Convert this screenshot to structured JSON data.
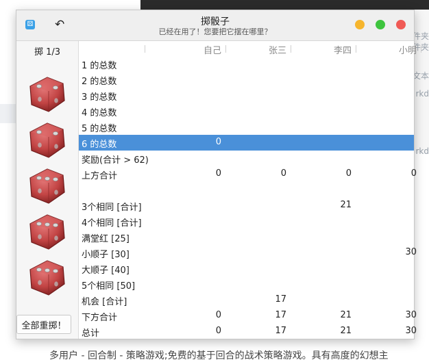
{
  "window": {
    "title": "掷骰子",
    "subtitle": "已经在用了！您要把它摆在哪里？"
  },
  "sidebar": {
    "roll_label": "掷 1/3",
    "dice": [
      {
        "value": 2,
        "kind": "die-icon"
      },
      {
        "value": 2,
        "kind": "die-icon"
      },
      {
        "value": 3,
        "kind": "die-icon"
      },
      {
        "value": 3,
        "kind": "die-icon"
      },
      {
        "value": 3,
        "kind": "die-icon"
      }
    ],
    "reroll_all_label": "全部重掷！"
  },
  "scores": {
    "players": [
      "自己",
      "张三",
      "李四",
      "小明"
    ],
    "rows": [
      {
        "label": "1 的总数",
        "values": [
          "",
          "",
          "",
          ""
        ]
      },
      {
        "label": "2 的总数",
        "values": [
          "",
          "",
          "",
          ""
        ]
      },
      {
        "label": "3 的总数",
        "values": [
          "",
          "",
          "",
          ""
        ]
      },
      {
        "label": "4 的总数",
        "values": [
          "",
          "",
          "",
          ""
        ]
      },
      {
        "label": "5 的总数",
        "values": [
          "",
          "",
          "",
          ""
        ]
      },
      {
        "label": "6 的总数",
        "values": [
          "0",
          "",
          "",
          ""
        ],
        "selected": true
      },
      {
        "label": "奖励(合计 > 62)",
        "values": [
          "",
          "",
          "",
          ""
        ]
      },
      {
        "label": "上方合计",
        "values": [
          "0",
          "0",
          "0",
          "0"
        ]
      },
      {
        "label": "",
        "values": [
          "",
          "",
          "",
          ""
        ]
      },
      {
        "label": "3个相同 [合计]",
        "values": [
          "",
          "",
          "21",
          ""
        ]
      },
      {
        "label": "4个相同 [合计]",
        "values": [
          "",
          "",
          "",
          ""
        ]
      },
      {
        "label": "满堂红 [25]",
        "values": [
          "",
          "",
          "",
          ""
        ]
      },
      {
        "label": "小顺子 [30]",
        "values": [
          "",
          "",
          "",
          "30"
        ]
      },
      {
        "label": "大顺子 [40]",
        "values": [
          "",
          "",
          "",
          ""
        ]
      },
      {
        "label": "5个相同 [50]",
        "values": [
          "",
          "",
          "",
          ""
        ]
      },
      {
        "label": "机会 [合计]",
        "values": [
          "",
          "17",
          "",
          ""
        ]
      },
      {
        "label": "下方合计",
        "values": [
          "0",
          "17",
          "21",
          "30"
        ]
      },
      {
        "label": "总计",
        "values": [
          "0",
          "17",
          "21",
          "30"
        ]
      }
    ]
  },
  "background": {
    "right_fragments": [
      "件夹",
      "件夹",
      "文本",
      "rkd",
      "rkd"
    ],
    "footer_text": "多用户 - 回合制 - 策略游戏;免费的基于回合的战术策略游戏。具有高度的幻想主"
  },
  "colors": {
    "selection": "#4a90d9",
    "die_red": "#c24444",
    "close": "#f05a55",
    "minimize": "#f6b52d",
    "maximize": "#3ec43e"
  }
}
